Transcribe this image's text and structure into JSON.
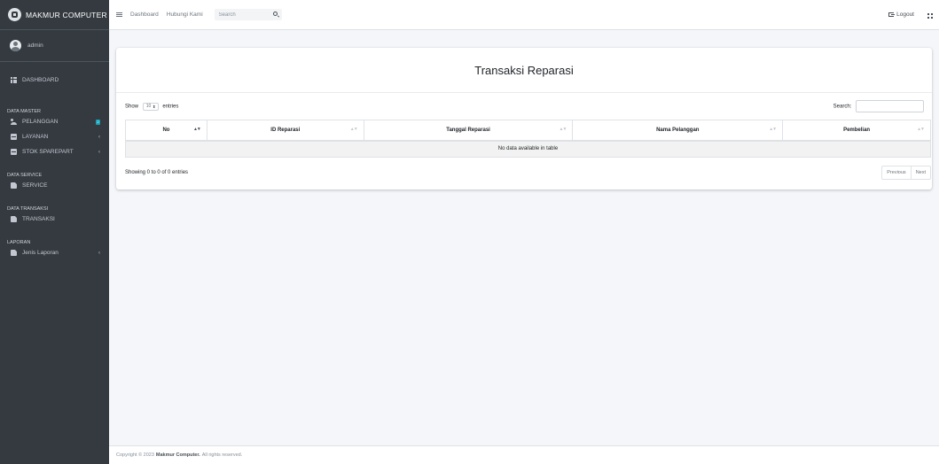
{
  "brand": {
    "name": "MAKMUR COMPUTER"
  },
  "user": {
    "name": "admin"
  },
  "sidebar": {
    "dashboard": "DASHBOARD",
    "headers": {
      "master": "DATA MASTER",
      "service": "DATA SERVICE",
      "transaksi": "DATA TRANSAKSI",
      "laporan": "LAPORAN"
    },
    "items": {
      "pelanggan": "PELANGGAN",
      "layanan": "LAYANAN",
      "stok": "STOK SPAREPART",
      "service": "SERVICE",
      "transaksi": "TRANSAKSI",
      "jenis_laporan": "Jenis Laporan"
    },
    "pelanggan_badge": "2"
  },
  "navbar": {
    "links": [
      "Dashboard",
      "Hubungi Kami"
    ],
    "search_placeholder": "Search",
    "logout": "Logout"
  },
  "page": {
    "title": "Transaksi Reparasi"
  },
  "table": {
    "show": "Show",
    "entries_value": "10",
    "entries": "entries",
    "search_label": "Search:",
    "columns": [
      "No",
      "ID Reparasi",
      "Tanggal Reparasi",
      "Nama Pelanggan",
      "Pembelian"
    ],
    "empty": "No data available in table",
    "info": "Showing 0 to 0 of 0 entries",
    "previous": "Previous",
    "next": "Next"
  },
  "footer": {
    "prefix": "Copyright © 2023",
    "company": "Makmur Computer.",
    "suffix": "All rights reserved."
  }
}
